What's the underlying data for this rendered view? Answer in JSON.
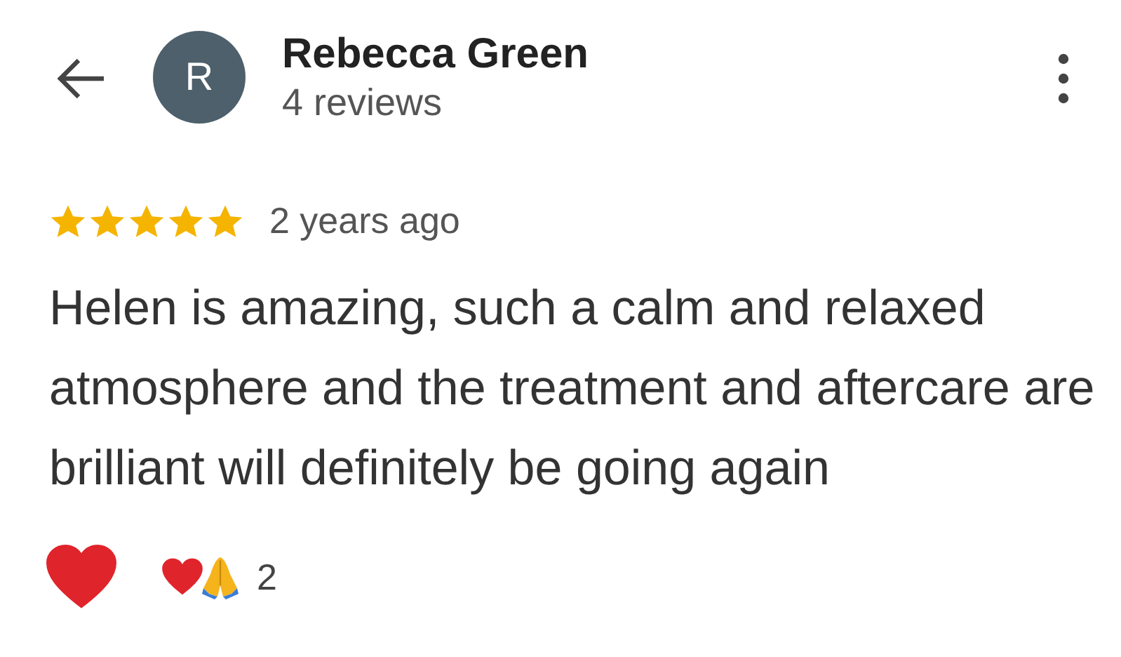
{
  "reviewer": {
    "initial": "R",
    "name": "Rebecca Green",
    "review_count": "4 reviews"
  },
  "review": {
    "stars": 5,
    "time": "2 years ago",
    "text": "Helen is amazing, such a calm and relaxed atmosphere and the treatment and aftercare are brilliant will definitely be going again"
  },
  "reactions": {
    "liked": true,
    "count": "2"
  }
}
